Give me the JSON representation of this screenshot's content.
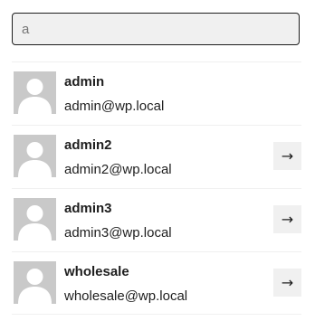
{
  "search": {
    "value": "a",
    "placeholder": ""
  },
  "users": [
    {
      "name": "admin",
      "email": "admin@wp.local",
      "avatar_icon": "default-avatar-icon",
      "action_icon": null
    },
    {
      "name": "admin2",
      "email": "admin2@wp.local",
      "avatar_icon": "default-avatar-icon",
      "action_icon": "→"
    },
    {
      "name": "admin3",
      "email": "admin3@wp.local",
      "avatar_icon": "default-avatar-icon",
      "action_icon": "→"
    },
    {
      "name": "wholesale",
      "email": "wholesale@wp.local",
      "avatar_icon": "default-avatar-icon",
      "action_icon": "→"
    }
  ],
  "colors": {
    "avatar_bg": "#c9c9c9",
    "avatar_fg": "#ffffff",
    "button_bg": "#f0f0f0",
    "text": "#1e1e1e"
  }
}
